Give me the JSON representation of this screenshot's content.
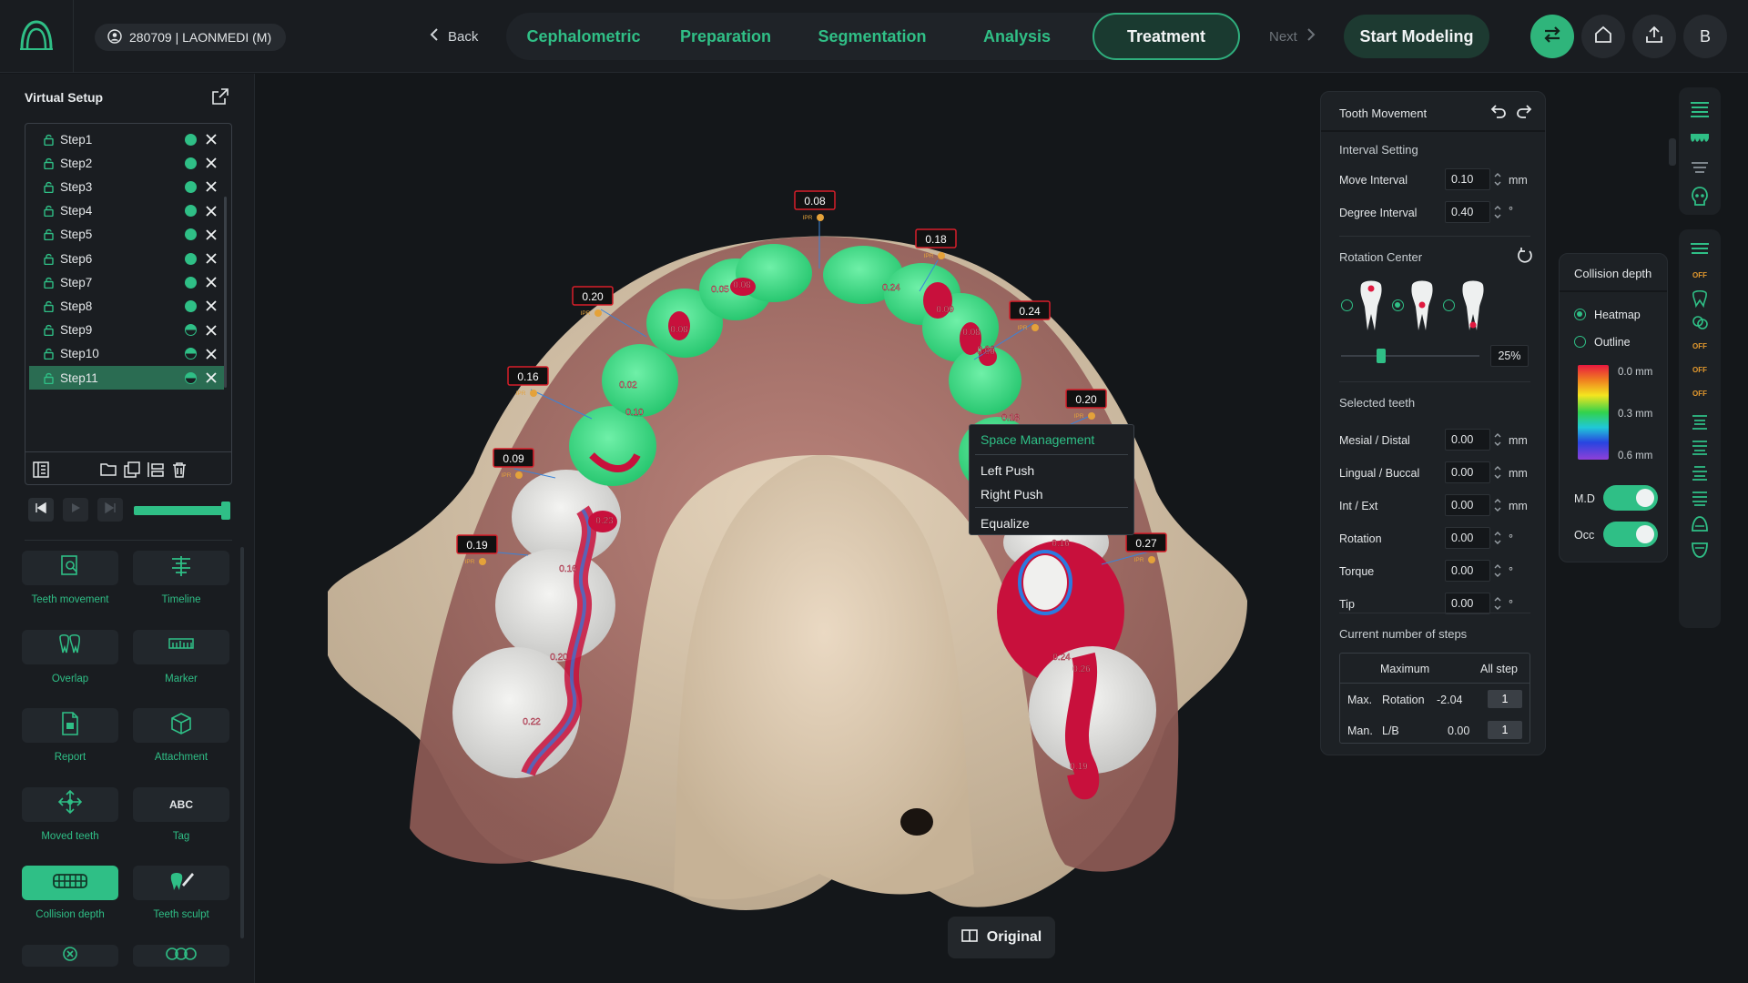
{
  "header": {
    "patient": "280709 | LAONMEDI (M)",
    "back": "Back",
    "next": "Next",
    "start_modeling": "Start Modeling",
    "user_initial": "B",
    "tabs": [
      {
        "label": "Cephalometric"
      },
      {
        "label": "Preparation"
      },
      {
        "label": "Segmentation"
      },
      {
        "label": "Analysis"
      },
      {
        "label": "Treatment",
        "active": true
      }
    ]
  },
  "virtual_setup": {
    "title": "Virtual Setup",
    "steps": [
      {
        "label": "Step1",
        "state": "full"
      },
      {
        "label": "Step2",
        "state": "full"
      },
      {
        "label": "Step3",
        "state": "full"
      },
      {
        "label": "Step4",
        "state": "full"
      },
      {
        "label": "Step5",
        "state": "full"
      },
      {
        "label": "Step6",
        "state": "full"
      },
      {
        "label": "Step7",
        "state": "full"
      },
      {
        "label": "Step8",
        "state": "full"
      },
      {
        "label": "Step9",
        "state": "half"
      },
      {
        "label": "Step10",
        "state": "half"
      },
      {
        "label": "Step11",
        "state": "half",
        "selected": true
      }
    ],
    "playback_progress": 1.0
  },
  "tools": [
    {
      "label": "Teeth movement"
    },
    {
      "label": "Timeline"
    },
    {
      "label": "Overlap"
    },
    {
      "label": "Marker"
    },
    {
      "label": "Report"
    },
    {
      "label": "Attachment"
    },
    {
      "label": "Moved teeth"
    },
    {
      "label": "Tag",
      "glyph": "ABC"
    },
    {
      "label": "Collision depth",
      "active": true
    },
    {
      "label": "Teeth sculpt"
    }
  ],
  "viewport": {
    "ipr_tag": "IPR",
    "ipr_labels": [
      "0.08",
      "0.18",
      "0.20",
      "0.24",
      "0.16",
      "0.20",
      "0.09",
      "0.19",
      "0.27"
    ],
    "collision_values": [
      "0.05",
      "0.08",
      "0.24",
      "0.08",
      "0.08",
      "0.02",
      "0.10",
      "0.09",
      "0.06",
      "0.26",
      "0.23",
      "0.16",
      "0.20",
      "0.22",
      "0.16",
      "0.24",
      "0.26",
      "0.19",
      "0.18"
    ],
    "original_button": "Original"
  },
  "context_menu": {
    "header": "Space Management",
    "items": [
      "Left Push",
      "Right Push",
      "Equalize"
    ]
  },
  "tooth_movement": {
    "title": "Tooth Movement",
    "interval_title": "Interval Setting",
    "move_interval": {
      "label": "Move Interval",
      "value": "0.10",
      "unit": "mm"
    },
    "degree_interval": {
      "label": "Degree Interval",
      "value": "0.40",
      "unit": "°"
    },
    "rotation_center": {
      "title": "Rotation Center",
      "selected_index": 1,
      "percent": "25%",
      "slider_value": 0.25
    },
    "selected_title": "Selected teeth",
    "fields": [
      {
        "label": "Mesial / Distal",
        "value": "0.00",
        "unit": "mm"
      },
      {
        "label": "Lingual / Buccal",
        "value": "0.00",
        "unit": "mm"
      },
      {
        "label": "Int / Ext",
        "value": "0.00",
        "unit": "mm"
      },
      {
        "label": "Rotation",
        "value": "0.00",
        "unit": "°"
      },
      {
        "label": "Torque",
        "value": "0.00",
        "unit": "°"
      },
      {
        "label": "Tip",
        "value": "0.00",
        "unit": "°"
      }
    ],
    "steps_title": "Current number of steps",
    "table": {
      "headers": [
        "Maximum",
        "All step"
      ],
      "rows": [
        {
          "label": "Max.",
          "metric": "Rotation",
          "value": "-2.04",
          "steps": "1"
        },
        {
          "label": "Man.",
          "metric": "L/B",
          "value": "0.00",
          "steps": "1"
        }
      ]
    }
  },
  "collision_depth": {
    "title": "Collision depth",
    "options": [
      {
        "label": "Heatmap",
        "selected": true
      },
      {
        "label": "Outline",
        "selected": false
      }
    ],
    "scale": [
      "0.0 mm",
      "0.3 mm",
      "0.6 mm"
    ],
    "toggles": [
      {
        "label": "M.D",
        "on": true
      },
      {
        "label": "Occ",
        "on": true
      }
    ]
  },
  "right_toolbar": {
    "off_label": "OFF"
  }
}
